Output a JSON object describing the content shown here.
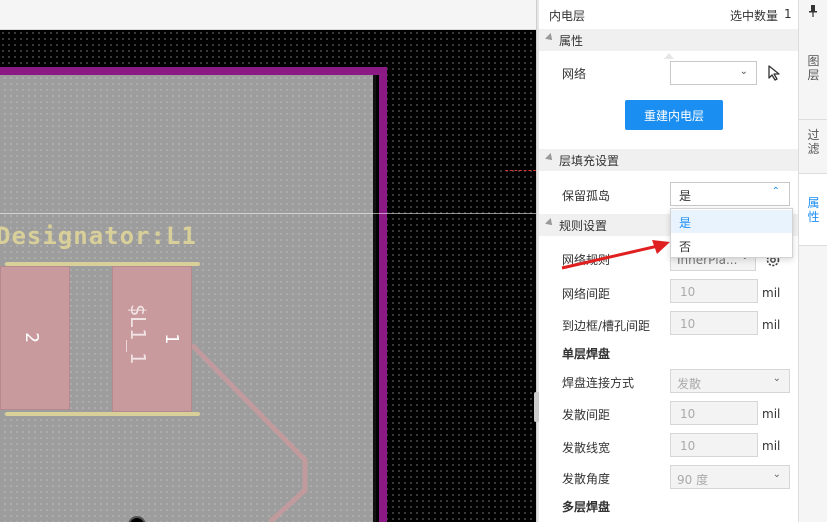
{
  "canvas": {
    "designator": "Designator:L1",
    "pad_1_number": "1",
    "pad_2_number": "2",
    "pad_1_net": "$L1_1"
  },
  "panel": {
    "object_type": "内电层",
    "selected_label": "选中数量",
    "selected_count": "1",
    "sections": {
      "properties": "属性",
      "fill": "层填充设置",
      "rules": "规则设置"
    },
    "net": {
      "label": "网络",
      "value": ""
    },
    "rebuild_button": "重建内电层",
    "keep_islands": {
      "label": "保留孤岛",
      "value": "是",
      "options": [
        "是",
        "否"
      ],
      "highlighted": "是"
    },
    "net_rule": {
      "label": "网络规则",
      "value": "InnerPla..."
    },
    "net_clearance": {
      "label": "网络间距",
      "value": "10",
      "unit": "mil"
    },
    "board_clearance": {
      "label": "到边框/槽孔间距",
      "value": "10",
      "unit": "mil"
    },
    "single_layer_pad": {
      "title": "单层焊盘",
      "connect_style": {
        "label": "焊盘连接方式",
        "value": "发散"
      },
      "spoke_gap": {
        "label": "发散间距",
        "value": "10",
        "unit": "mil"
      },
      "spoke_width": {
        "label": "发散线宽",
        "value": "10",
        "unit": "mil"
      },
      "spoke_angle": {
        "label": "发散角度",
        "value": "90 度"
      }
    },
    "multi_layer_pad": {
      "title": "多层焊盘"
    }
  },
  "tabs": [
    "图层",
    "过滤",
    "属性"
  ],
  "active_tab": "属性",
  "colors": {
    "accent": "#1b8ef2",
    "board_outline": "#8b1a84",
    "silkscreen": "#d9cf99",
    "pad": "#c89a9e",
    "annotation_arrow": "#e02020"
  }
}
